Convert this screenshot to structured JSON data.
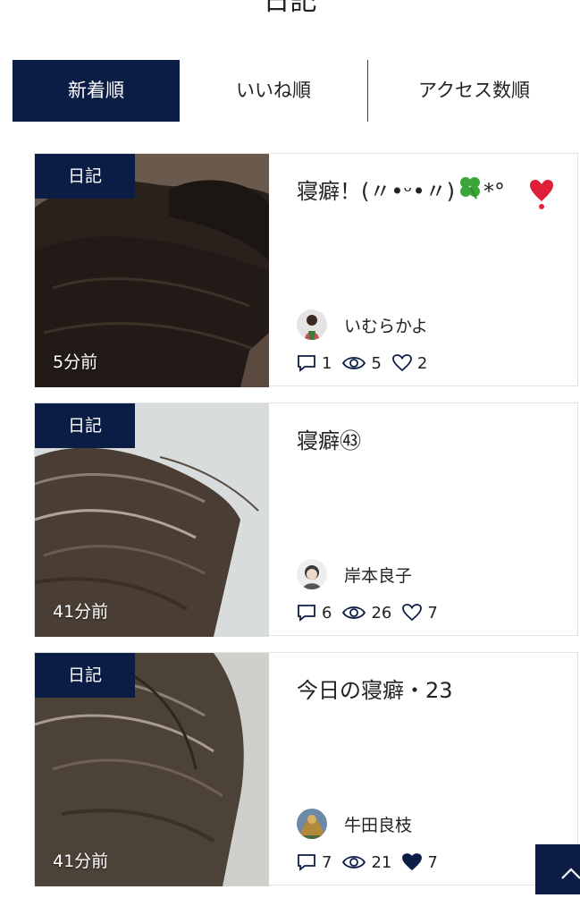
{
  "page": {
    "title": "日記"
  },
  "tabs": [
    {
      "label": "新着順",
      "active": true
    },
    {
      "label": "いいね順",
      "active": false
    },
    {
      "label": "アクセス数順",
      "active": false
    }
  ],
  "posts": [
    {
      "category": "日記",
      "time": "5分前",
      "title": "寝癖！(〃•ᵕ•〃)",
      "title_suffix": "*°",
      "title_emoji": "four-leaf-clover-icon",
      "extra_emoji": "red-heart-icon",
      "author": "いむらかよ",
      "comments": "1",
      "views": "5",
      "likes": "2",
      "liked": false
    },
    {
      "category": "日記",
      "time": "41分前",
      "title": "寝癖㊸",
      "author": "岸本良子",
      "comments": "6",
      "views": "26",
      "likes": "7",
      "liked": false
    },
    {
      "category": "日記",
      "time": "41分前",
      "title": "今日の寝癖・23",
      "author": "牛田良枝",
      "comments": "7",
      "views": "21",
      "likes": "7",
      "liked": true
    }
  ],
  "colors": {
    "accent": "#0c1d45",
    "border": "#e2e2e2",
    "heart": "#e0203a",
    "clover": "#3aa63a"
  },
  "back_to_top": {
    "icon": "chevron-up-icon"
  }
}
